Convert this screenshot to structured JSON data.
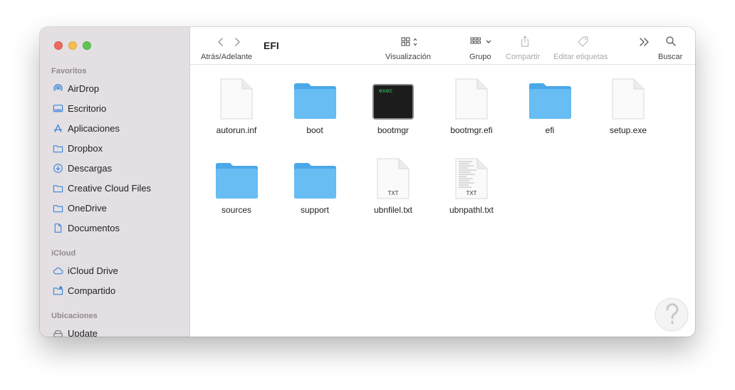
{
  "window": {
    "title": "EFI"
  },
  "toolbar": {
    "nav_label": "Atrás/Adelante",
    "view_label": "Visualización",
    "group_label": "Grupo",
    "share_label": "Compartir",
    "tags_label": "Editar etiquetas",
    "search_label": "Buscar"
  },
  "sidebar": {
    "favorites_title": "Favoritos",
    "favorites": [
      {
        "label": "AirDrop",
        "icon": "airdrop-icon"
      },
      {
        "label": "Escritorio",
        "icon": "desktop-icon"
      },
      {
        "label": "Aplicaciones",
        "icon": "applications-icon"
      },
      {
        "label": "Dropbox",
        "icon": "folder-icon"
      },
      {
        "label": "Descargas",
        "icon": "download-icon"
      },
      {
        "label": "Creative Cloud Files",
        "icon": "folder-icon"
      },
      {
        "label": "OneDrive",
        "icon": "folder-icon"
      },
      {
        "label": "Documentos",
        "icon": "document-icon"
      }
    ],
    "icloud_title": "iCloud",
    "icloud": [
      {
        "label": "iCloud Drive",
        "icon": "cloud-icon"
      },
      {
        "label": "Compartido",
        "icon": "shared-folder-icon"
      }
    ],
    "locations_title": "Ubicaciones",
    "locations": [
      {
        "label": "Update",
        "icon": "drive-icon"
      }
    ]
  },
  "files": [
    {
      "name": "autorun.inf",
      "type": "document"
    },
    {
      "name": "boot",
      "type": "folder"
    },
    {
      "name": "bootmgr",
      "type": "exec",
      "badge": "exec"
    },
    {
      "name": "bootmgr.efi",
      "type": "document"
    },
    {
      "name": "efi",
      "type": "folder"
    },
    {
      "name": "setup.exe",
      "type": "document"
    },
    {
      "name": "sources",
      "type": "folder"
    },
    {
      "name": "support",
      "type": "folder"
    },
    {
      "name": "ubnfilel.txt",
      "type": "txt",
      "badge": "TXT"
    },
    {
      "name": "ubnpathl.txt",
      "type": "txt-lines",
      "badge": "TXT"
    }
  ],
  "colors": {
    "sidebar_bg": "#e4dfe3",
    "accent_blue": "#3a86d8",
    "folder_blue": "#68bdf3",
    "exec_green": "#3fd66a"
  }
}
